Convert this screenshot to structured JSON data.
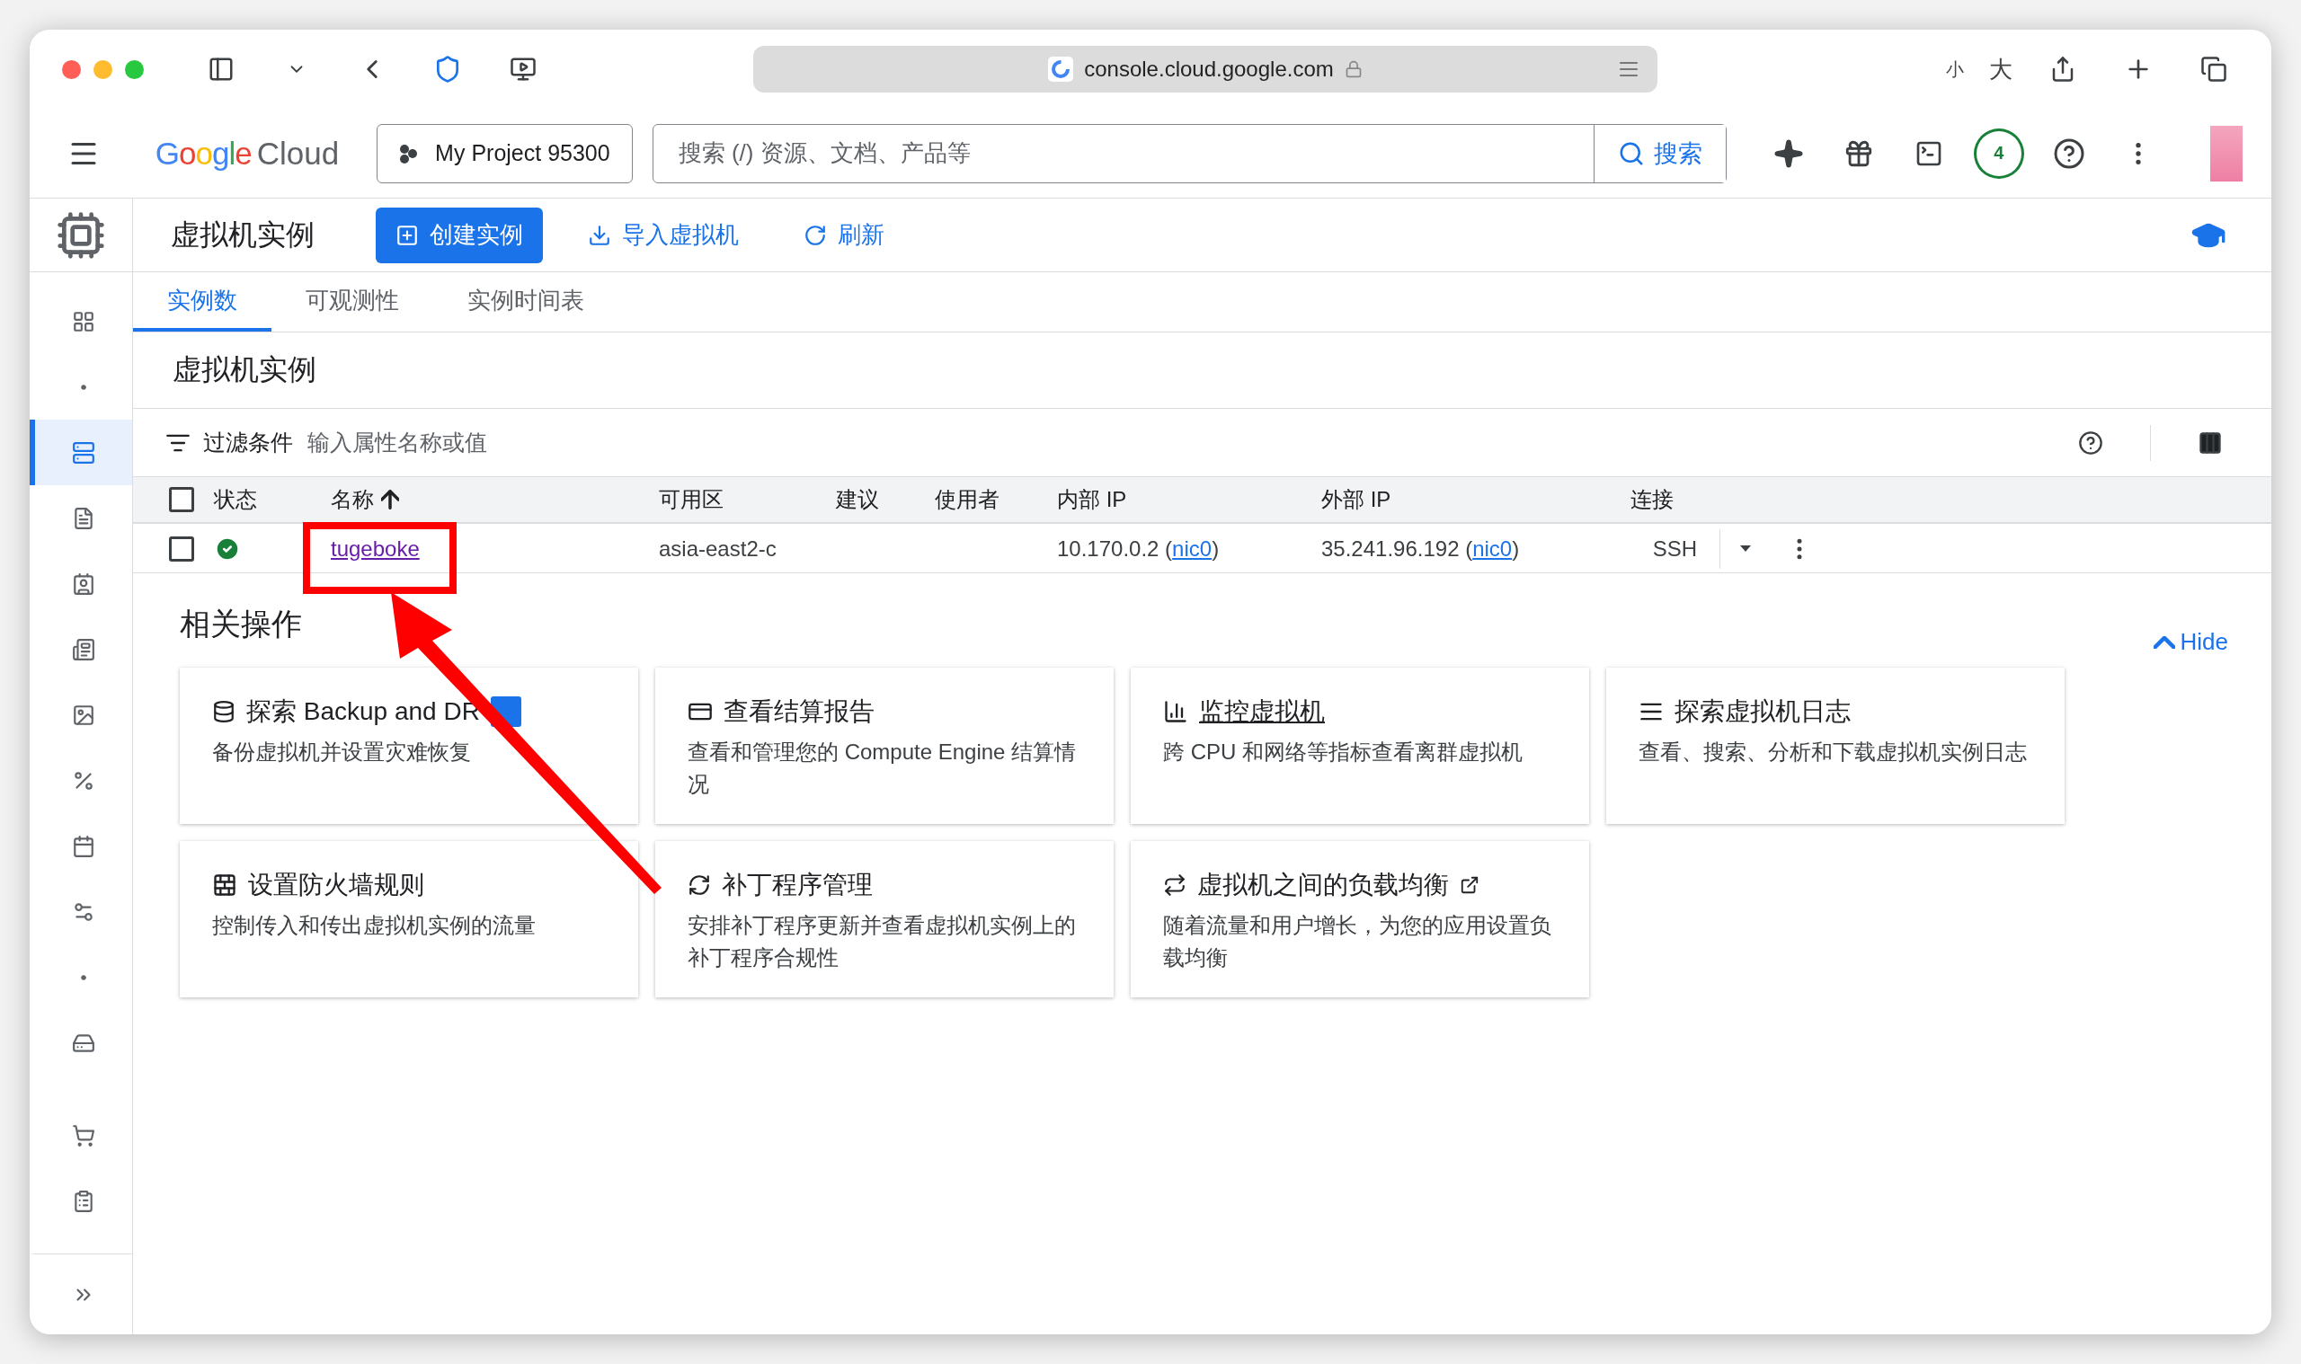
{
  "browser": {
    "address": "console.cloud.google.com",
    "text_small": "小",
    "text_large": "大"
  },
  "topbar": {
    "logo_brand": "Google",
    "logo_product": "Cloud",
    "project": "My Project 95300",
    "search_placeholder": "搜索 (/) 资源、文档、产品等",
    "search_button": "搜索",
    "notifications": "4"
  },
  "page_header": {
    "title": "虚拟机实例",
    "actions": [
      {
        "label": "创建实例",
        "kind": "primary"
      },
      {
        "label": "导入虚拟机",
        "kind": "import"
      },
      {
        "label": "刷新",
        "kind": "refresh"
      }
    ]
  },
  "tabs": [
    {
      "label": "实例数",
      "selected": true
    },
    {
      "label": "可观测性",
      "selected": false
    },
    {
      "label": "实例时间表",
      "selected": false
    }
  ],
  "section_title": "虚拟机实例",
  "filter": {
    "label": "过滤条件",
    "placeholder": "输入属性名称或值"
  },
  "table": {
    "header_checked": false,
    "columns": [
      {
        "label": "状态",
        "sorted": false
      },
      {
        "label": "名称",
        "sorted": true
      },
      {
        "label": "可用区",
        "sorted": false
      },
      {
        "label": "建议",
        "sorted": false
      },
      {
        "label": "使用者",
        "sorted": false
      },
      {
        "label": "内部 IP",
        "sorted": false
      },
      {
        "label": "外部 IP",
        "sorted": false
      },
      {
        "label": "连接",
        "sorted": false
      }
    ],
    "rows": [
      {
        "checked": false,
        "running": true,
        "name": "tugeboke",
        "zone": "asia-east2-c",
        "internal_ip": "10.170.0.2 (",
        "internal_nic": "nic0",
        "internal_close": ")",
        "external_ip": "35.241.96.192 (",
        "external_nic": "nic0",
        "external_close": ")",
        "connect": "SSH"
      }
    ]
  },
  "sidebar": {
    "items": [
      {
        "selected": false
      },
      {
        "selected": false
      },
      {
        "selected": true
      },
      {
        "selected": false
      },
      {
        "selected": false
      },
      {
        "selected": false
      },
      {
        "selected": false
      },
      {
        "selected": false
      },
      {
        "selected": false
      },
      {
        "selected": false
      },
      {
        "selected": false
      },
      {
        "selected": false
      },
      {
        "selected": false
      },
      {
        "selected": false
      }
    ]
  },
  "related": {
    "title": "相关操作",
    "hide": "Hide",
    "cards": [
      {
        "kind": "backup",
        "title": "探索 Backup and DR",
        "badge": true,
        "link": false,
        "external": false,
        "description": "备份虚拟机并设置灾难恢复"
      },
      {
        "kind": "billing",
        "title": "查看结算报告",
        "badge": false,
        "link": false,
        "external": false,
        "description": "查看和管理您的 Compute Engine 结算情况"
      },
      {
        "kind": "monitor",
        "title": "监控虚拟机",
        "badge": false,
        "link": true,
        "external": false,
        "description": "跨 CPU 和网络等指标查看离群虚拟机"
      },
      {
        "kind": "logs",
        "title": "探索虚拟机日志",
        "badge": false,
        "link": false,
        "external": false,
        "description": "查看、搜索、分析和下载虚拟机实例日志"
      },
      {
        "kind": "firewall",
        "title": "设置防火墙规则",
        "badge": false,
        "link": false,
        "external": false,
        "description": "控制传入和传出虚拟机实例的流量"
      },
      {
        "kind": "patch",
        "title": "补丁程序管理",
        "badge": false,
        "link": false,
        "external": false,
        "description": "安排补丁程序更新并查看虚拟机实例上的补丁程序合规性"
      },
      {
        "kind": "balance",
        "title": "虚拟机之间的负载均衡",
        "badge": false,
        "link": false,
        "external": true,
        "description": "随着流量和用户增长，为您的应用设置负载均衡"
      }
    ]
  }
}
